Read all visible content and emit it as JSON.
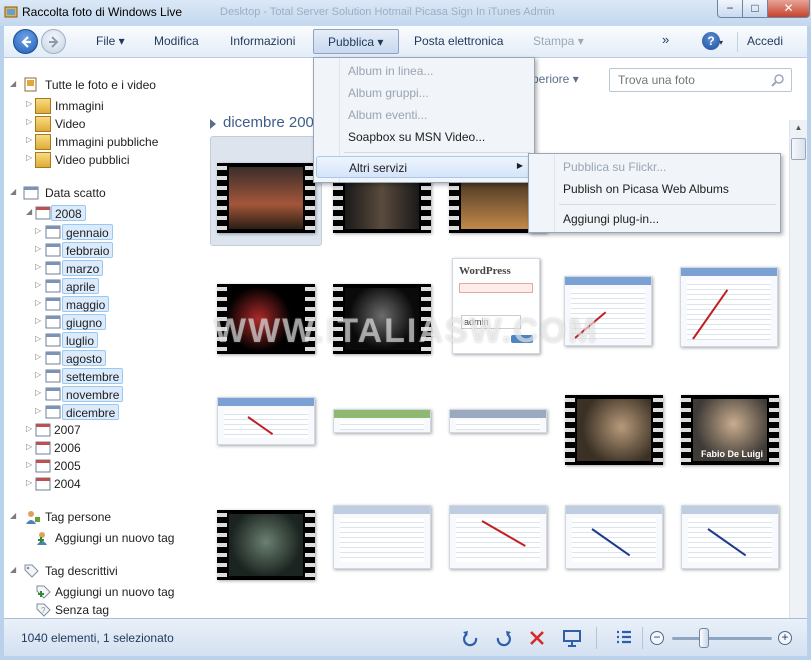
{
  "window": {
    "title": "Raccolta foto di Windows Live",
    "background_tabs": "Desktop - Total Server Solution   Hotmail   Picasa Sign In   iTunes Admin",
    "controls": {
      "minimize": "−",
      "maximize": "□",
      "close": "✕"
    }
  },
  "menubar": {
    "file": "File ▾",
    "modifica": "Modifica",
    "informazioni": "Informazioni",
    "pubblica": "Pubblica ▾",
    "posta": "Posta elettronica",
    "stampa": "Stampa ▾",
    "more": "»",
    "help": "?",
    "accedi": "Accedi"
  },
  "pubblica_menu": {
    "items": [
      {
        "label": "Album in linea...",
        "enabled": false
      },
      {
        "label": "Album gruppi...",
        "enabled": false
      },
      {
        "label": "Album eventi...",
        "enabled": false
      },
      {
        "label": "Soapbox su MSN Video...",
        "enabled": true
      },
      {
        "label": "Altri servizi",
        "enabled": true,
        "submenu": true
      }
    ]
  },
  "altri_servizi_menu": {
    "items": [
      {
        "label": "Pubblica su Flickr...",
        "enabled": false
      },
      {
        "label": "Publish on Picasa Web Albums",
        "enabled": true
      },
      {
        "label": "Aggiungi plug-in...",
        "enabled": true
      }
    ]
  },
  "sidebar": {
    "all_photos": "Tutte le foto e i video",
    "categories": [
      "Immagini",
      "Video",
      "Immagini pubbliche",
      "Video pubblici"
    ],
    "data_scatto": "Data scatto",
    "year_selected": "2008",
    "months": [
      "gennaio",
      "febbraio",
      "marzo",
      "aprile",
      "maggio",
      "giugno",
      "luglio",
      "agosto",
      "settembre",
      "novembre",
      "dicembre"
    ],
    "other_years": [
      "2007",
      "2006",
      "2005",
      "2004"
    ],
    "tag_persone": "Tag persone",
    "add_tag_persone": "Aggiungi un nuovo tag",
    "tag_descrittivi": "Tag descrittivi",
    "add_tag_descrittivi": "Aggiungi un nuovo tag",
    "senza_tag": "Senza tag"
  },
  "content": {
    "sort_label": "periore ▾",
    "search_placeholder": "Trova una foto",
    "group_header": "dicembre 2008",
    "watermark": "WWW.ITALIASW.COM",
    "thumb_labels": {
      "wordpress": "WordPress",
      "admin": "admin",
      "fabio": "Fabio De Luigi"
    }
  },
  "status": {
    "text": "1040 elementi, 1 selezionato",
    "zoom_level": 0.3
  }
}
